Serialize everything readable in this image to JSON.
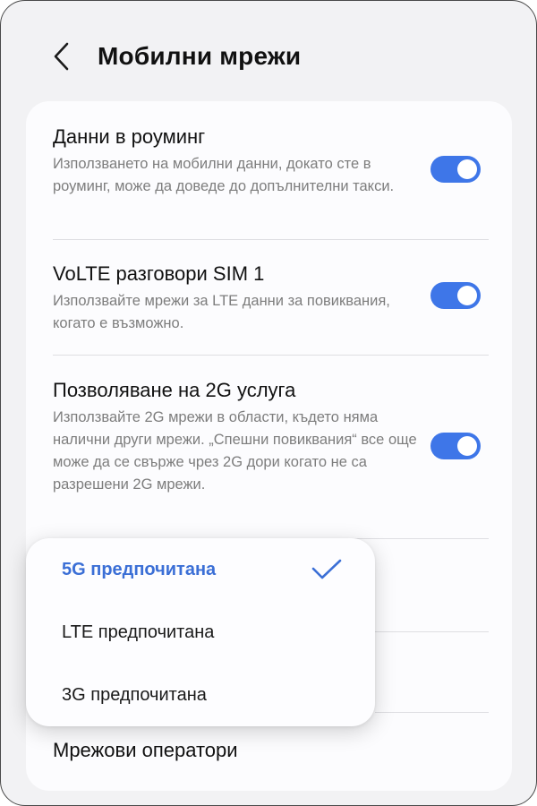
{
  "header": {
    "title": "Мобилни мрежи",
    "back_icon": "chevron-left-icon"
  },
  "settings": [
    {
      "title": "Данни в роуминг",
      "description": "Използването на мобилни данни, докато сте в роуминг, може да доведе до допълнителни такси.",
      "enabled": true
    },
    {
      "title": "VoLTE разговори SIM 1",
      "description": "Използвайте мрежи за LTE данни за повиквания, когато е възможно.",
      "enabled": true
    },
    {
      "title": "Позволяване на 2G услуга",
      "description": "Използвайте 2G мрежи в области, където няма налични други мрежи. „Спешни повиквания“ все още може да се свърже чрез 2G дори когато не са разрешени 2G мрежи.",
      "enabled": true
    }
  ],
  "network_operators": {
    "title": "Мрежови оператори"
  },
  "network_mode_menu": {
    "options": [
      {
        "label": "5G предпочитана",
        "selected": true
      },
      {
        "label": "LTE предпочитана",
        "selected": false
      },
      {
        "label": "3G предпочитана",
        "selected": false
      }
    ],
    "check_icon": "checkmark-icon"
  },
  "colors": {
    "accent": "#3e76e8",
    "selected_text": "#3b6fd6",
    "background": "#f2f2f4",
    "card": "#fcfcfe",
    "secondary_text": "#7d7d7d"
  }
}
